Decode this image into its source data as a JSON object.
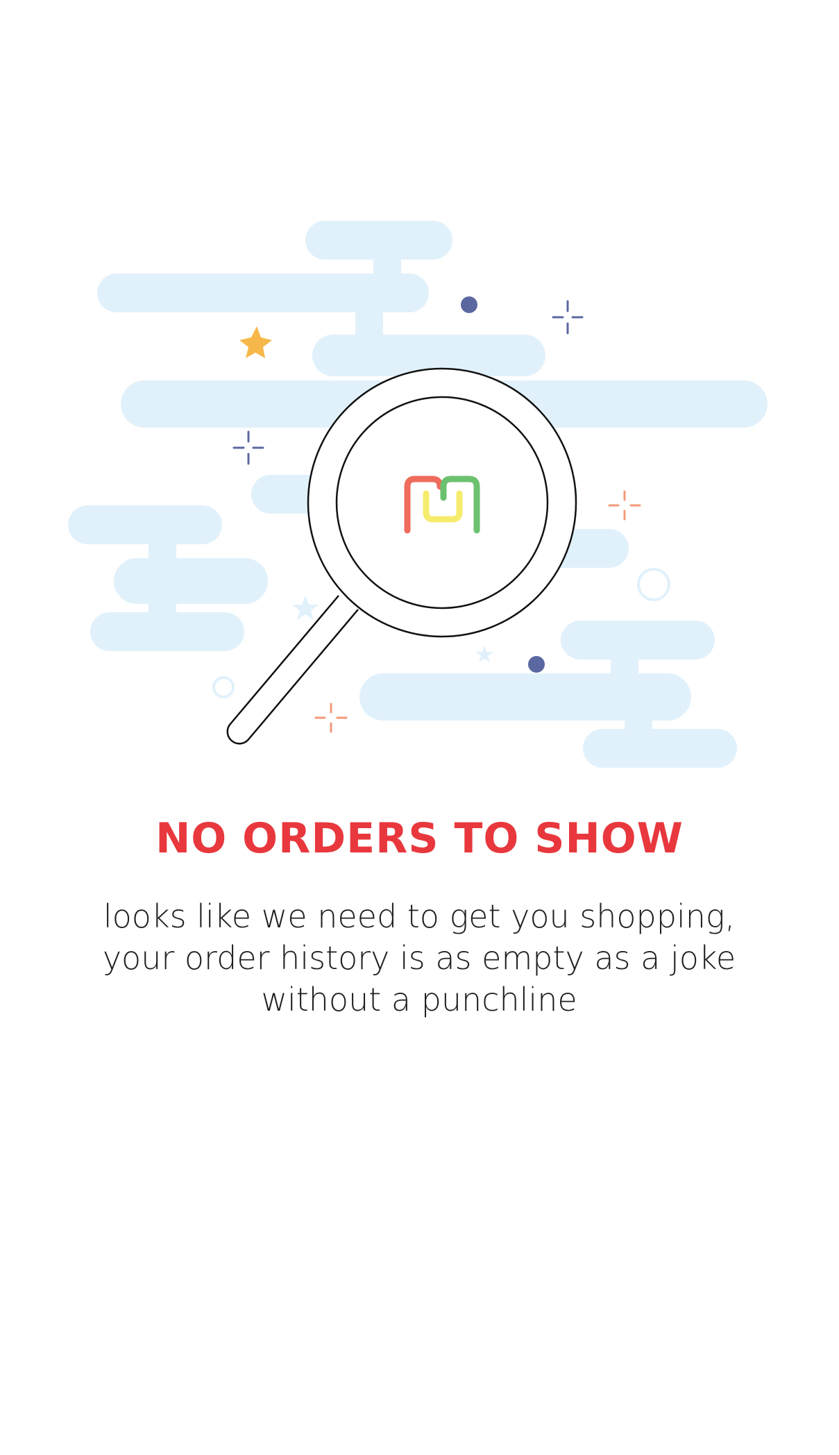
{
  "empty_state": {
    "title": "NO ORDERS TO SHOW",
    "message_lines": [
      "looks like we need to get you shopping,",
      "your order history is as empty as a joke",
      "without a punchline"
    ]
  },
  "illustration": {
    "icon": "magnifying-glass-icon",
    "logo": "brand-logo",
    "colors": {
      "cloud": "#e1f1fb",
      "outline": "#111111",
      "dot": "#5b67a0",
      "star": "#f6b84a",
      "sparkle_orange": "#f29a78",
      "logo_red": "#ef6b5b",
      "logo_yellow": "#f6ec6c",
      "logo_green": "#6cc16e",
      "title": "#e8383d"
    }
  }
}
